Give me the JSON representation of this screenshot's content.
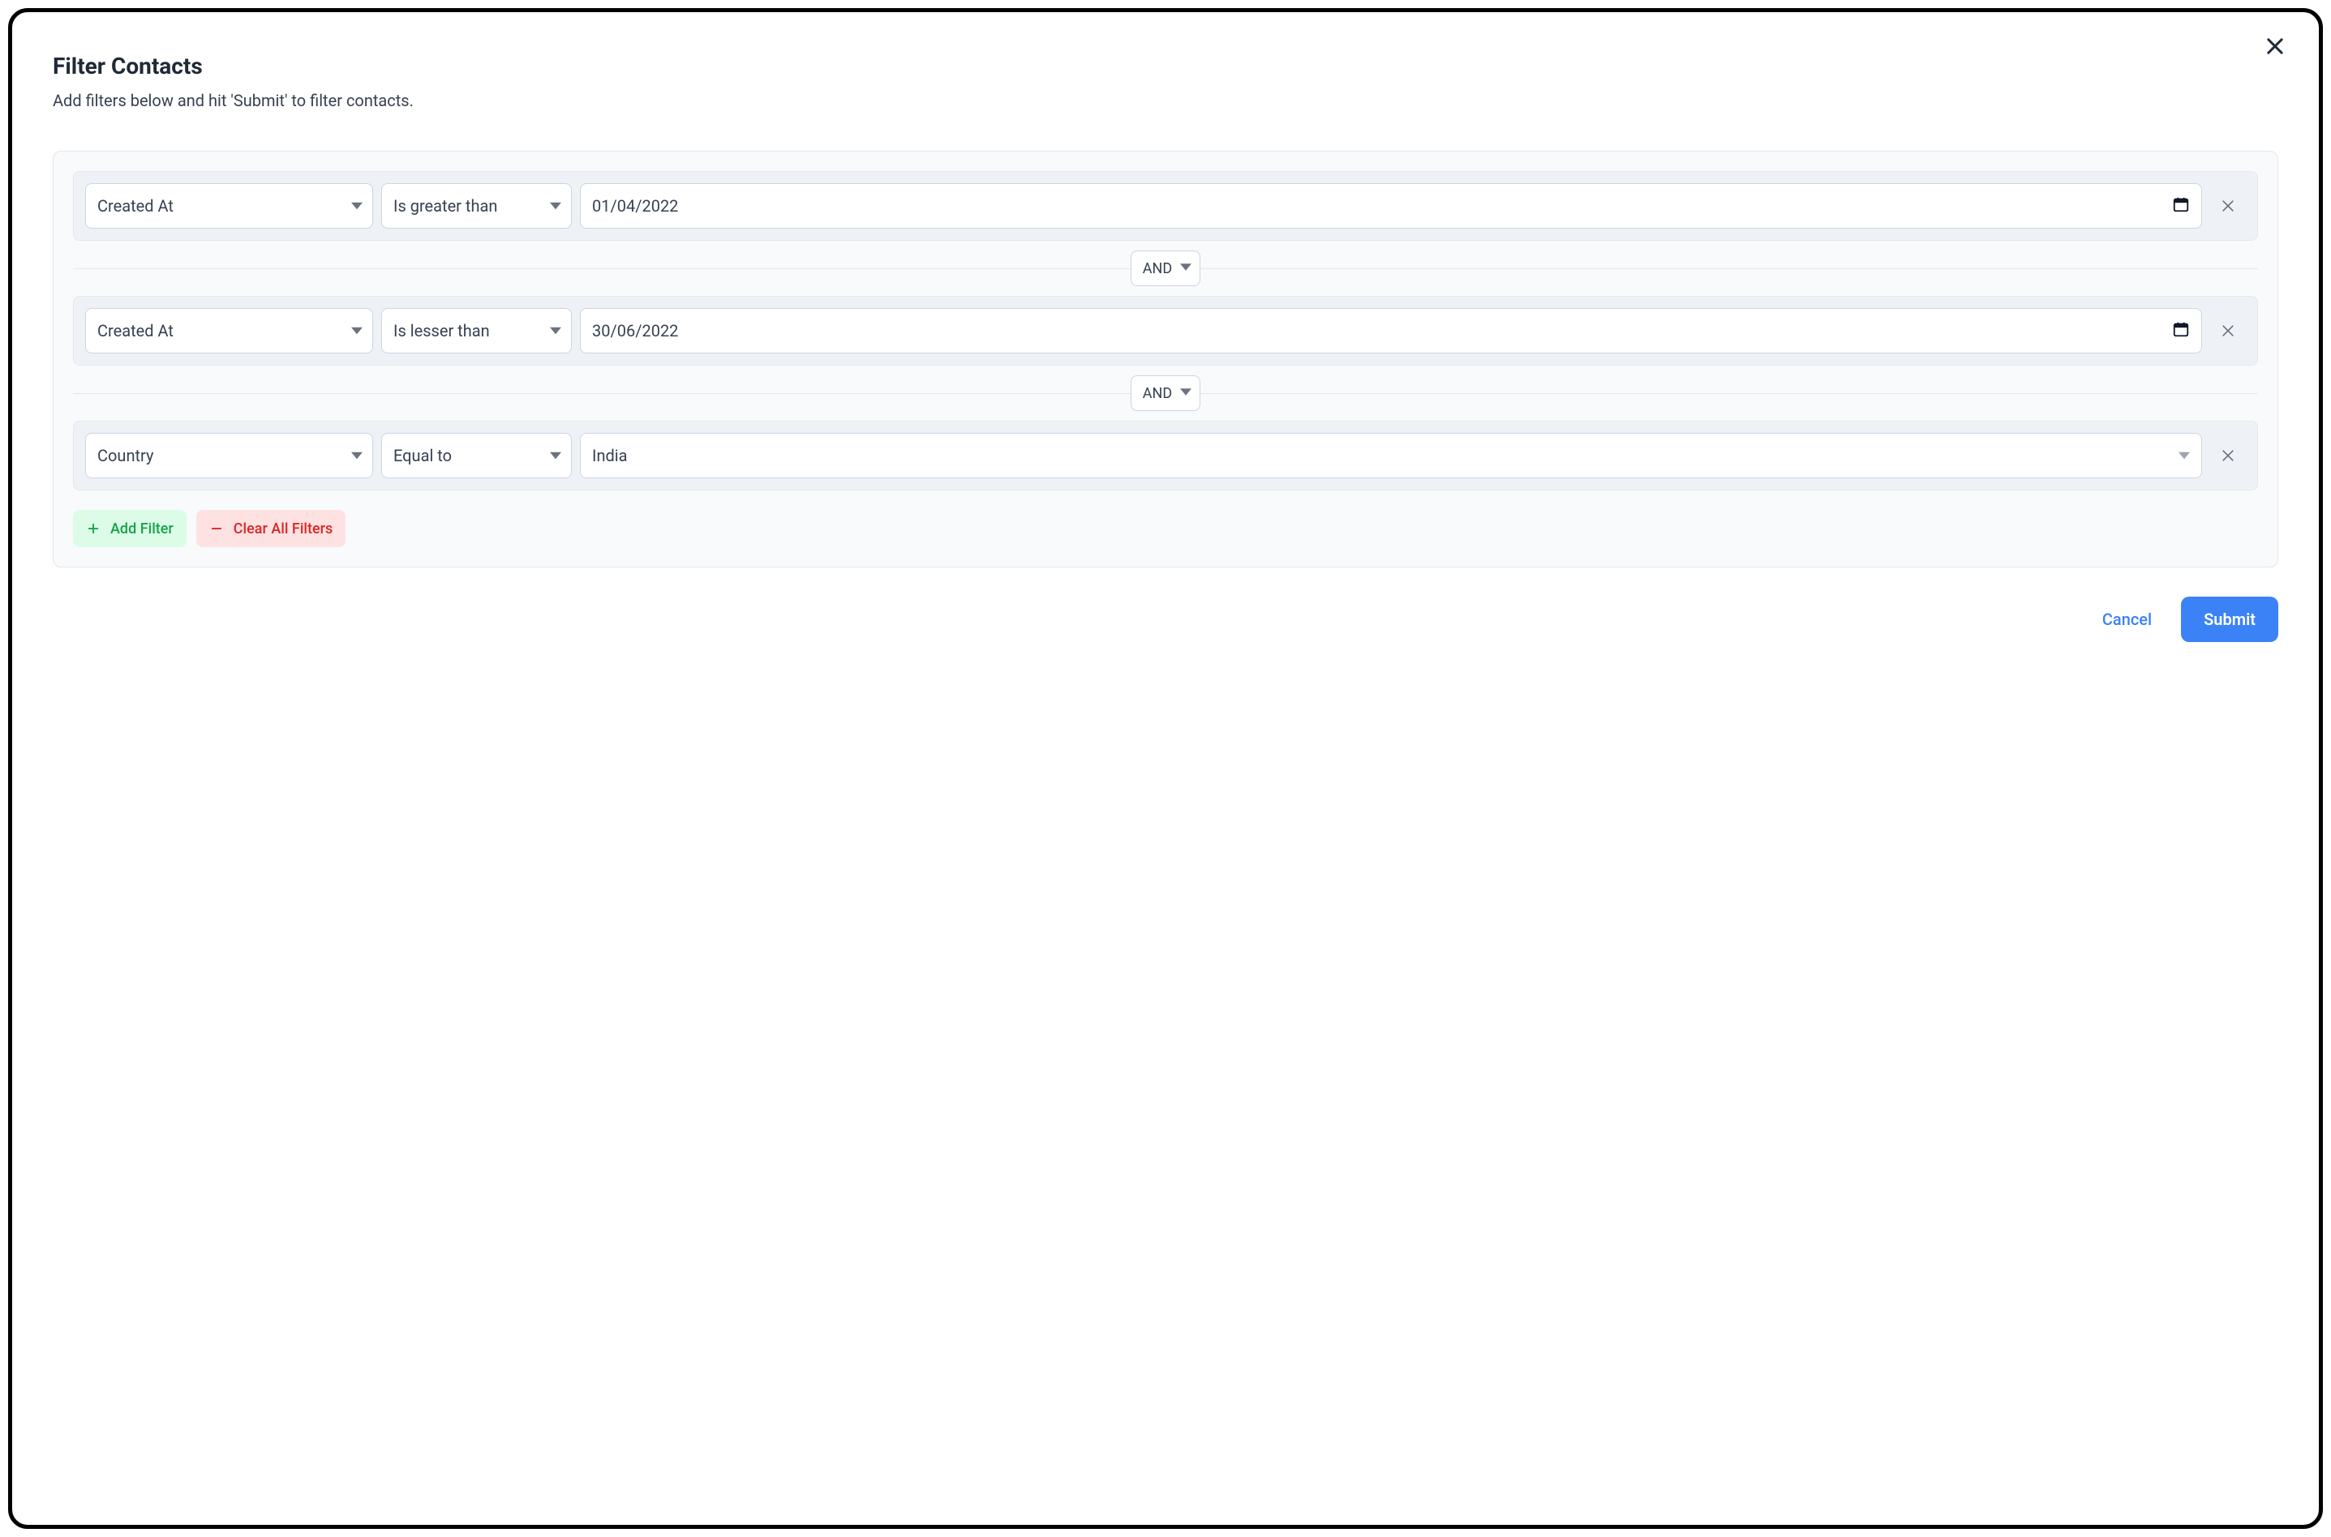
{
  "header": {
    "title": "Filter Contacts",
    "subtitle": "Add filters below and hit 'Submit' to filter contacts."
  },
  "filters": [
    {
      "field": "Created At",
      "operator": "Is greater than",
      "value": "01/04/2022",
      "value_type": "date",
      "connector_after": "AND"
    },
    {
      "field": "Created At",
      "operator": "Is lesser than",
      "value": "30/06/2022",
      "value_type": "date",
      "connector_after": "AND"
    },
    {
      "field": "Country",
      "operator": "Equal to",
      "value": "India",
      "value_type": "select",
      "connector_after": null
    }
  ],
  "actions": {
    "add_filter": "Add Filter",
    "clear_all": "Clear All Filters"
  },
  "footer": {
    "cancel": "Cancel",
    "submit": "Submit"
  }
}
